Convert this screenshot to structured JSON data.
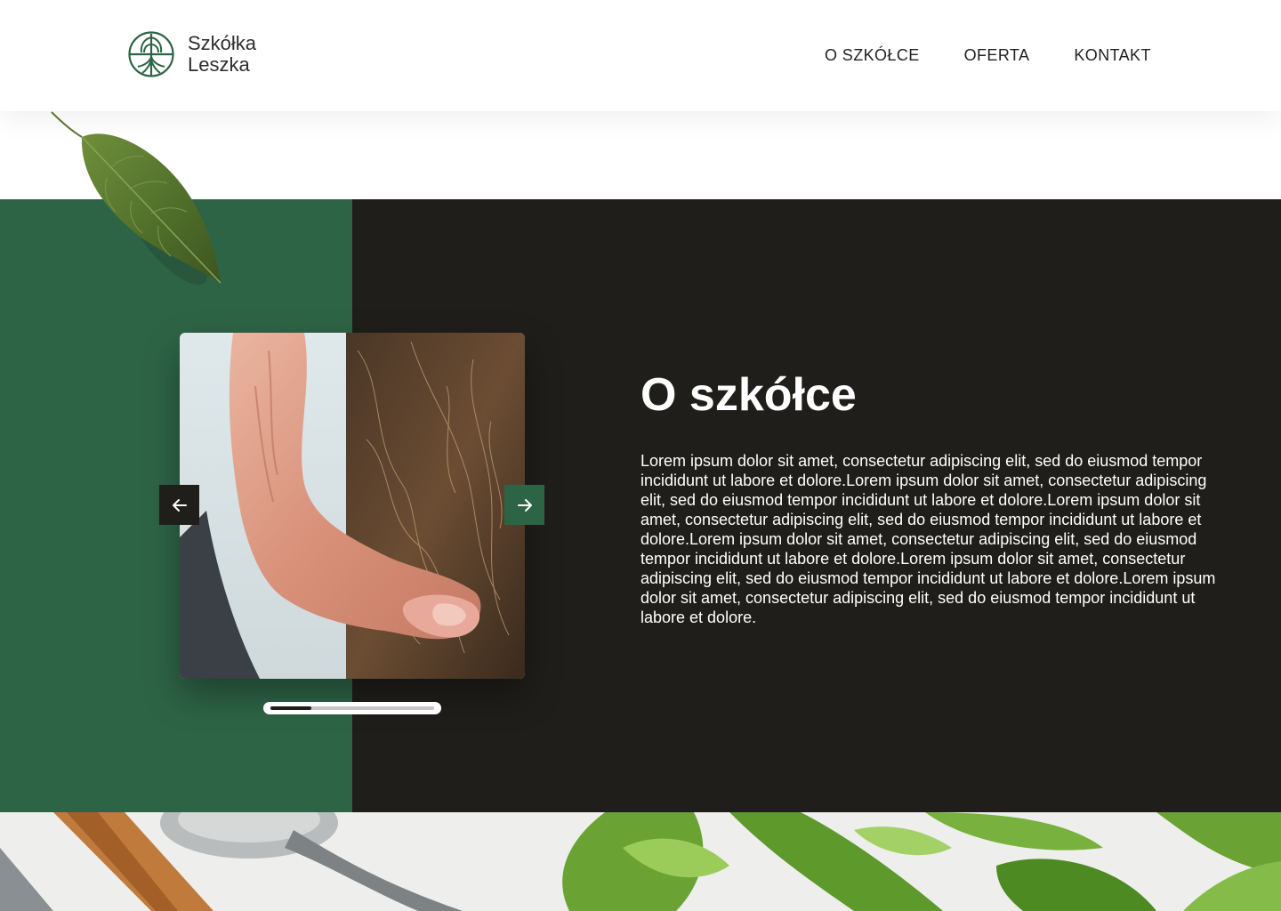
{
  "header": {
    "logo": {
      "line1": "Szkółka",
      "line2": "Leszka",
      "icon": "tree-roots-icon"
    },
    "nav": [
      {
        "label": "O SZKÓŁCE"
      },
      {
        "label": "OFERTA"
      },
      {
        "label": "KONTAKT"
      }
    ]
  },
  "about": {
    "title": "O szkółce",
    "text": "Lorem ipsum dolor sit amet, consectetur adipiscing elit, sed do eiusmod tempor incididunt ut labore et dolore.Lorem ipsum dolor sit amet, consectetur adipiscing elit, sed do eiusmod tempor incididunt ut labore et dolore.Lorem ipsum dolor sit amet, consectetur adipiscing elit, sed do eiusmod tempor incididunt ut labore et dolore.Lorem ipsum dolor sit amet, consectetur adipiscing elit, sed do eiusmod tempor incididunt ut labore et dolore.Lorem ipsum dolor sit amet, consectetur adipiscing elit, sed do eiusmod tempor incididunt ut labore et dolore.Lorem ipsum dolor sit amet, consectetur adipiscing elit, sed do eiusmod tempor incididunt ut labore et dolore.",
    "slider": {
      "prev_icon": "arrow-left-icon",
      "next_icon": "arrow-right-icon",
      "progress_fraction": 0.25
    }
  },
  "colors": {
    "brand_green": "#2e6446",
    "dark": "#1f1e1b",
    "white": "#ffffff"
  }
}
